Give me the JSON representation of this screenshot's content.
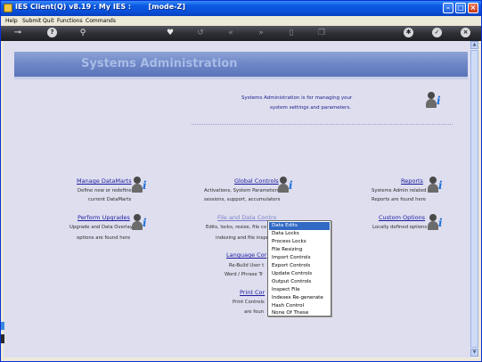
{
  "window": {
    "title": "IES Client(Q) v8.19 : My IES :       [mode-Z]",
    "icon": "app-icon",
    "controls": {
      "minimize": "minimize-icon",
      "maximize": "maximize-icon",
      "close": "close-icon"
    }
  },
  "menubar": {
    "items": [
      "Help",
      "Submit",
      "Quit",
      "Functions",
      "Commands"
    ]
  },
  "toolbar": {
    "icons": [
      "key-icon",
      "help-icon",
      "search-icon",
      "heart-icon",
      "refresh-icon",
      "back-icon",
      "forward-icon",
      "document-icon",
      "copy-icon",
      "settings-icon",
      "check-icon",
      "close-icon"
    ],
    "glyphs": {
      "key": "⊸",
      "help": "?",
      "search": "⚲",
      "heart": "♥",
      "refresh": "↺",
      "back": "«",
      "forward": "»",
      "document": "▯",
      "copy": "❐",
      "settings": "✱",
      "check": "✓",
      "close": "×"
    }
  },
  "header": {
    "title": "Systems Administration"
  },
  "intro": {
    "line1": "Systems Administration is for managing your",
    "line2": "system settings and parameters."
  },
  "sections": {
    "manage_datamarts": {
      "title": "Manage DataMarts",
      "desc1": "Define new or redefine",
      "desc2": "current DataMarts"
    },
    "global_controls": {
      "title": "Global Controls",
      "desc1": "Activations, System Parameters,",
      "desc2": "sessions, support, accumulators"
    },
    "reports": {
      "title": "Reports",
      "desc1": "Systems Admin related",
      "desc2": "Reports are found here"
    },
    "perform_upgrades": {
      "title": "Perform Upgrades",
      "desc1": "Upgrade and Data Overlay",
      "desc2": "options are found here"
    },
    "file_data_controls": {
      "title": "File and Data Contro",
      "desc1": "Edits, locks, resize, file co",
      "desc2": "indexing and file inspe"
    },
    "custom_options": {
      "title": "Custom Options",
      "desc1": "Locally defined options"
    },
    "language_controls": {
      "title": "Language Cor",
      "desc1": "Re-Build User t",
      "desc2": "Word / Phrase Tr"
    },
    "print_controls": {
      "title": "Print Cor",
      "desc1": "Print Controls",
      "desc2": "are foun"
    }
  },
  "popup": {
    "selected_index": 0,
    "items": [
      "Data Edits",
      "Data Locks",
      "Process Locks",
      "File Resizing",
      "Import Controls",
      "Export Controls",
      "Update Controls",
      "Output Controls",
      "Inspect File",
      "Indexes Re-generate",
      "Hash Control",
      "None Of These"
    ]
  },
  "colors": {
    "title_bar": "#0a4fd8",
    "header_band": "#6f88c8",
    "content_bg": "#dedeef",
    "link": "#1c1ca0",
    "selected": "#316ac5"
  }
}
